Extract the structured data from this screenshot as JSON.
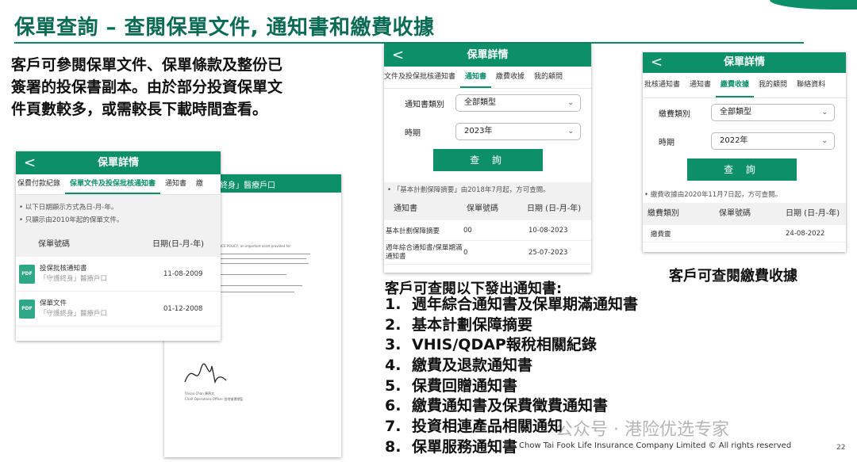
{
  "slide": {
    "title": "保單查詢 – 查閱保單文件, 通知書和繳費收據",
    "intro": "客戶可參閱保單文件、保單條款及整份已簽署的投保書副本。由於部分投資保單文件頁數較多，或需較長下載時間查看。",
    "notice_label": "客戶可查閱以下發出通知書:",
    "receipt_label": "客戶可查閱繳費收據",
    "notice_items": [
      {
        "num": "1.",
        "text": "週年綜合通知書及保單期滿通知書"
      },
      {
        "num": "2.",
        "text": "基本計劃保障摘要"
      },
      {
        "num": "3.",
        "text": "VHIS/QDAP報稅相關紀錄"
      },
      {
        "num": "4.",
        "text": "繳費及退款通知書"
      },
      {
        "num": "5.",
        "text": "保費回贈通知書"
      },
      {
        "num": "6.",
        "text": "繳費通知書及保費徵費通知書"
      },
      {
        "num": "7.",
        "text": "投資相連產品相關通知"
      },
      {
        "num": "8.",
        "text": "保單服務通知書"
      }
    ],
    "watermark": "公众号 · 港险优选专家",
    "footer": "Chow Tai Fook Life Insurance Company Limited © All rights reserved",
    "page_number": "22"
  },
  "panel_docs": {
    "back": "<",
    "header": "保單詳情",
    "tabs": [
      "保費付款紀錄",
      "保單文件及投保批核通知書",
      "通知書",
      "繳"
    ],
    "notes": [
      "• 以下日期顯示方式為日-月-年。",
      "• 只顯示由2010年起的保單文件。"
    ],
    "col_policy": "保單號碼",
    "col_date": "日期(日-月-年)",
    "files": [
      {
        "icon": "PDF",
        "name": "投保批核通知書",
        "product": "「守護終身」醫療戶口",
        "date": "11-08-2009"
      },
      {
        "icon": "PDF",
        "name": "保單文件",
        "product": "「守護終身」醫療戶口",
        "date": "01-12-2008"
      }
    ]
  },
  "doc_preview": {
    "header": "守護終身」醫療戶口",
    "policy_text": "RANCE POLICY, an important asset provided for",
    "sign_name": "Vivian Chan 陳薇文",
    "sign_title": "Chief Operations Officer 首席營運總監"
  },
  "panel_notices": {
    "back": "<",
    "header": "保單詳情",
    "tabs": [
      "文件及投保批核通知書",
      "通知書",
      "繳費收據",
      "我的顧問"
    ],
    "type_label": "通知書類別",
    "type_value": "全部類型",
    "period_label": "時期",
    "period_value": "2023年",
    "query_button": "查 詢",
    "note": "• 「基本計劃保障摘要」由2018年7月起，方可查閱。",
    "col_name": "通知書",
    "col_policy": "保單號碼",
    "col_date": "日期 (日-月-年)",
    "rows": [
      {
        "name": "基本計劃保障摘要",
        "policy": "00",
        "date": "10-08-2023"
      },
      {
        "name": "週年綜合通知書/保單期滿通知書",
        "policy": "0",
        "date": "25-07-2023"
      }
    ]
  },
  "panel_receipts": {
    "back": "<",
    "header": "保單詳情",
    "tabs": [
      "批核通知書",
      "通知書",
      "繳費收據",
      "我的顧問",
      "聯絡資料"
    ],
    "type_label": "繳費類別",
    "type_value": "全部類型",
    "period_label": "時期",
    "period_value": "2022年",
    "query_button": "查 詢",
    "note": "• 繳費收據由2020年11月7日起，方可查閱。",
    "col_type": "繳費類別",
    "col_policy": "保單號碼",
    "col_date": "日期 (日-月-年)",
    "rows": [
      {
        "type": "繳費靈",
        "date": "24-08-2022"
      }
    ]
  },
  "colors": {
    "brand_green": "#0d8f6a",
    "title_green": "#0b6b55"
  }
}
